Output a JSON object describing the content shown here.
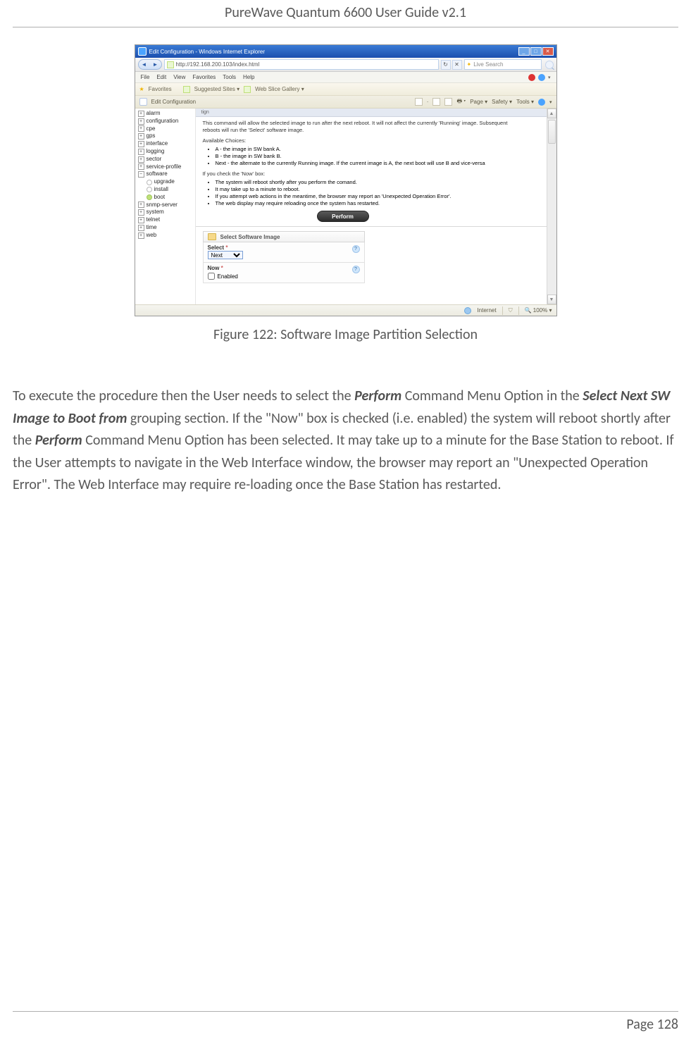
{
  "header_title": "PureWave Quantum 6600 User Guide v2.1",
  "figure_caption": "Figure 122: Software Image Partition Selection",
  "page_label": "Page 128",
  "body_text": {
    "p1a": "To execute the procedure then the User needs to select the ",
    "perform": "Perform",
    "p1b": " Command Menu Option in the ",
    "select_next": "Select Next SW Image to Boot from",
    "p1c": " grouping section. If the \"Now\" box is checked (i.e. enabled) the system will reboot shortly after the ",
    "p1d": " Command Menu Option has been selected. It may take up to a minute for the Base Station to reboot. If the User attempts to navigate in the Web Interface window, the browser may report an \"Unexpected Operation Error\". The Web Interface may require re-loading once the Base Station has restarted."
  },
  "ie": {
    "title": "Edit Configuration - Windows Internet Explorer",
    "address": "http://192.168.200.103/index.html",
    "search_placeholder": "Live Search",
    "menubar": [
      "File",
      "Edit",
      "View",
      "Favorites",
      "Tools",
      "Help"
    ],
    "fav_label": "Favorites",
    "fav_links": [
      "Suggested Sites ▾",
      "Web Slice Gallery ▾"
    ],
    "tab_label": "Edit Configuration",
    "toolbar_items": [
      "Page ▾",
      "Safety ▾",
      "Tools ▾"
    ],
    "status_internet": "Internet",
    "status_zoom": "100%"
  },
  "tree": {
    "items": [
      {
        "pm": "+",
        "label": "alarm"
      },
      {
        "pm": "+",
        "label": "configuration"
      },
      {
        "pm": "+",
        "label": "cpe"
      },
      {
        "pm": "+",
        "label": "gps"
      },
      {
        "pm": "+",
        "label": "interface"
      },
      {
        "pm": "+",
        "label": "logging"
      },
      {
        "pm": "+",
        "label": "sector"
      },
      {
        "pm": "+",
        "label": "service-profile"
      },
      {
        "pm": "−",
        "label": "software"
      },
      {
        "pm": "+",
        "label": "snmp-server"
      },
      {
        "pm": "+",
        "label": "system"
      },
      {
        "pm": "+",
        "label": "telnet"
      },
      {
        "pm": "+",
        "label": "time"
      },
      {
        "pm": "+",
        "label": "web"
      }
    ],
    "software_children": [
      "upgrade",
      "install",
      "boot"
    ]
  },
  "panel": {
    "gray_tab": "tign",
    "intro1": "This command will allow the selected image to run after the next reboot. It will not affect the currently 'Running' image. Subsequent reboots will run the 'Select' software image.",
    "avail_label": "Available Choices:",
    "avail_list": [
      "A - the image in SW bank A.",
      "B - the image in SW bank B.",
      "Next - the alternate to the currently Running image. If the current image is A, the next boot will use B and vice-versa"
    ],
    "now_label": "If you check the 'Now' box:",
    "now_list": [
      "The system will reboot shortly after you perform the comand.",
      "It may take up to a minute to reboot.",
      "If you attempt web actions in the meantime, the browser may report an 'Unexpected Operation Error'.",
      "The web display may require reloading once the system has restarted."
    ],
    "perform_label": "Perform",
    "folder_label": "Select Software Image",
    "select_label": "Select",
    "select_value": "Next",
    "now_field_label": "Now",
    "enabled_label": "Enabled",
    "help_glyph": "?"
  }
}
